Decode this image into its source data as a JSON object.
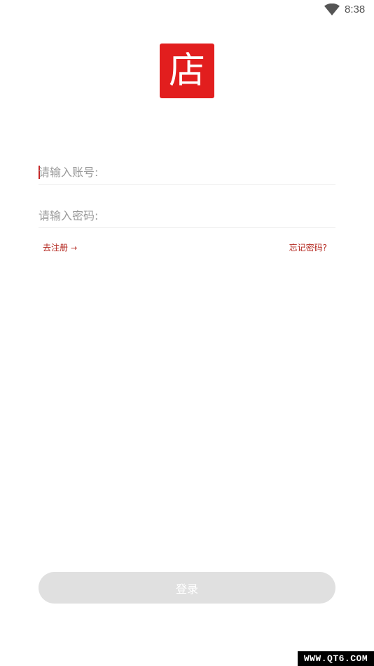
{
  "status_bar": {
    "time": "8:38",
    "wifi_icon": "wifi-icon"
  },
  "logo": {
    "glyph": "店",
    "background": "#e21e1e"
  },
  "form": {
    "account_placeholder": "请输入账号:",
    "password_placeholder": "请输入密码:",
    "register_label": "去注册",
    "register_arrow": "→",
    "forgot_label": "忘记密码?"
  },
  "login_button": {
    "label": "登录",
    "background": "#e0e0e0"
  },
  "watermark": {
    "text": "WWW.QT6.COM"
  },
  "colors": {
    "accent": "#b3261e",
    "cursor": "#c62828"
  }
}
